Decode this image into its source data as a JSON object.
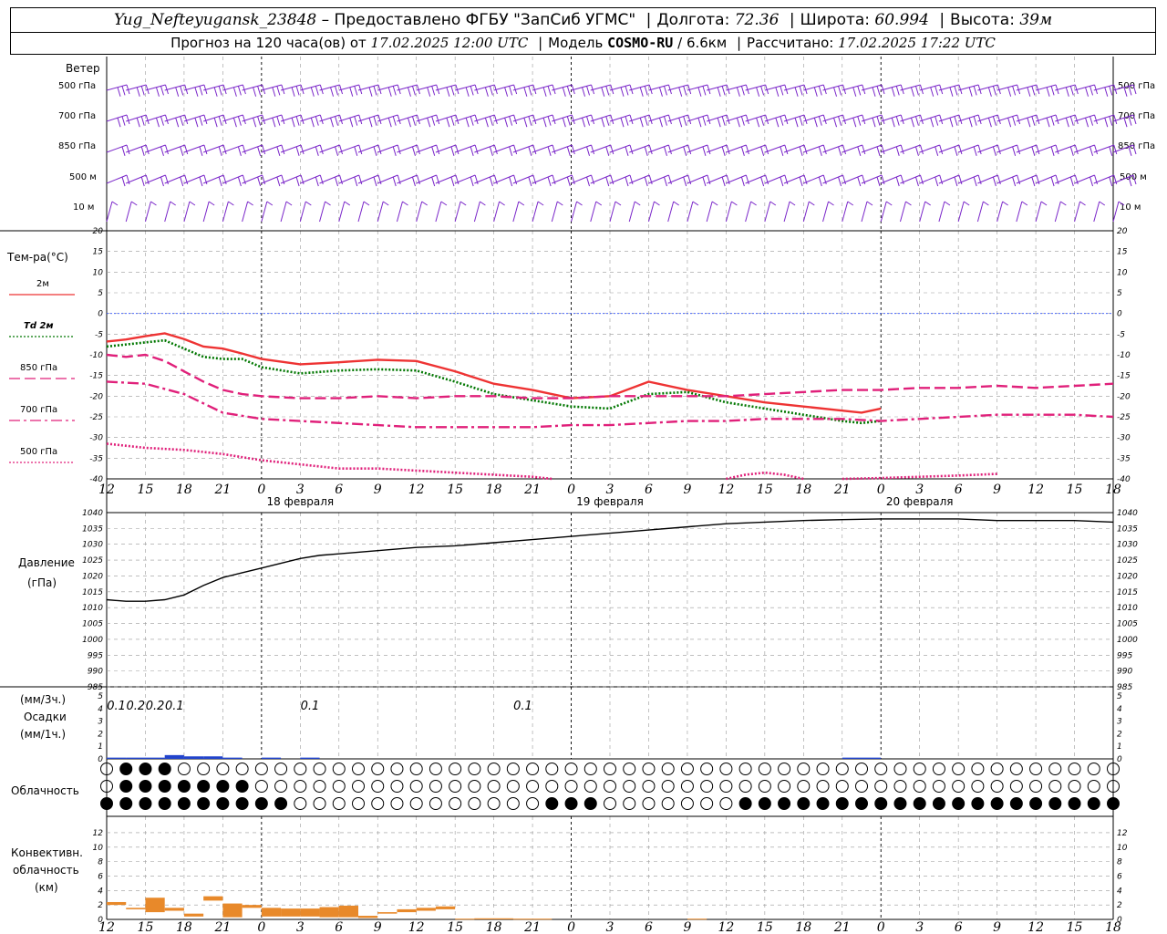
{
  "header": {
    "station": "Yug_Nefteyugansk_23848",
    "provider": "– Предоставлено ФГБУ \"ЗапСиб УГМС\"",
    "lon_label": "Долгота:",
    "lon": "72.36",
    "lat_label": "Широта:",
    "lat": "60.994",
    "alt_label": "Высота:",
    "alt": "39м",
    "forecast_label": "Прогноз на 120 часа(ов) от",
    "forecast_time": "17.02.2025 12:00 UTC",
    "model_label": "Модель",
    "model": "COSMO-RU",
    "model_res": "/ 6.6км",
    "calc_label": "Рассчитано:",
    "calc_time": "17.02.2025 17:22 UTC"
  },
  "wind": {
    "title": "Ветер",
    "levels": [
      "500 гПа",
      "700 гПа",
      "850 гПа",
      "500 м",
      "10 м"
    ],
    "color": "#7a26c9"
  },
  "temp_panel": {
    "title": "Тем-ра(°C)",
    "legend": [
      {
        "label": "2м",
        "color": "#ee3333",
        "style": "solid"
      },
      {
        "label": "Td 2м",
        "color": "#007700",
        "style": "dotted"
      },
      {
        "label": "850 гПа",
        "color": "#e0207a",
        "style": "dashed"
      },
      {
        "label": "700 гПа",
        "color": "#e0207a",
        "style": "dashdot"
      },
      {
        "label": "500 гПа",
        "color": "#e0207a",
        "style": "dotted"
      }
    ],
    "yticks": [
      "20",
      "15",
      "10",
      "5",
      "0",
      "-5",
      "-10",
      "-15",
      "-20",
      "-25",
      "-30",
      "-35",
      "-40"
    ]
  },
  "hour_ticks": [
    "12",
    "15",
    "18",
    "21",
    "0",
    "3",
    "6",
    "9",
    "12",
    "15",
    "18",
    "21",
    "0",
    "3",
    "6",
    "9",
    "12",
    "15",
    "18",
    "21",
    "0",
    "3",
    "6",
    "9",
    "12",
    "15",
    "18"
  ],
  "dates": [
    "18 февраля",
    "19 февраля",
    "20 февраля"
  ],
  "pressure_panel": {
    "title": "Давление",
    "unit": "(гПа)",
    "yticks": [
      "1040",
      "1035",
      "1030",
      "1025",
      "1020",
      "1015",
      "1010",
      "1005",
      "1000",
      "995",
      "990",
      "985"
    ]
  },
  "precip_panel": {
    "unit_3h": "(мм/3ч.)",
    "title": "Осадки",
    "unit_1h": "(мм/1ч.)",
    "yticks": [
      "5",
      "4",
      "3",
      "2",
      "1",
      "0"
    ],
    "labels": [
      {
        "hour": 1.5,
        "text": "0.1"
      },
      {
        "hour": 4.5,
        "text": "0.2"
      },
      {
        "hour": 7.5,
        "text": "0.2"
      },
      {
        "hour": 10.5,
        "text": "0.1"
      },
      {
        "hour": 31.5,
        "text": "0.1"
      },
      {
        "hour": 64.5,
        "text": "0.1"
      }
    ]
  },
  "cloud_panel": {
    "title": "Облачность"
  },
  "conv_panel": {
    "title1": "Конвективн.",
    "title2": "облачность",
    "unit": "(км)",
    "yticks": [
      "12",
      "10",
      "8",
      "6",
      "4",
      "2",
      "0"
    ]
  },
  "chart_data": [
    {
      "type": "line",
      "title": "Тем-ра(°C)",
      "x_unit": "hours from 17.02.2025 12:00 UTC",
      "ylim": [
        -40,
        20
      ],
      "series": [
        {
          "name": "2м",
          "x": [
            0,
            3,
            6,
            9,
            12,
            15,
            18,
            21,
            24,
            30,
            36,
            42,
            48,
            54,
            60,
            66,
            72,
            78,
            84,
            90,
            96,
            102,
            108,
            114,
            117,
            120
          ],
          "values": [
            -6.8,
            -6.3,
            -5.5,
            -4.8,
            -6.2,
            -8.0,
            -8.5,
            -9.7,
            -11.0,
            -12.3,
            -11.8,
            -11.2,
            -11.5,
            -14.0,
            -17.0,
            -18.5,
            -20.5,
            -20.0,
            -16.5,
            -18.5,
            -20.0,
            -21.5,
            -22.5,
            -23.5,
            -24.0,
            -23.0
          ]
        },
        {
          "name": "Td 2м",
          "x": [
            0,
            3,
            6,
            9,
            12,
            15,
            18,
            21,
            24,
            30,
            36,
            42,
            48,
            54,
            60,
            66,
            72,
            78,
            84,
            90,
            96,
            102,
            108,
            114,
            117,
            120
          ],
          "values": [
            -8.0,
            -7.5,
            -7.0,
            -6.5,
            -8.5,
            -10.5,
            -11.0,
            -11.0,
            -13.0,
            -14.5,
            -13.8,
            -13.5,
            -13.8,
            -16.5,
            -19.5,
            -21.0,
            -22.5,
            -23.0,
            -19.5,
            -19.0,
            -21.5,
            -23.0,
            -24.5,
            -26.0,
            -26.5,
            -26.0
          ]
        },
        {
          "name": "850 гПа",
          "x": [
            0,
            3,
            6,
            9,
            12,
            15,
            18,
            21,
            24,
            30,
            36,
            42,
            48,
            54,
            60,
            66,
            72,
            78,
            84,
            90,
            96,
            102,
            108,
            114,
            120,
            126,
            132,
            138,
            144,
            150,
            156
          ],
          "values": [
            -10.0,
            -10.5,
            -10.0,
            -11.5,
            -14.0,
            -16.5,
            -18.5,
            -19.5,
            -20.0,
            -20.5,
            -20.5,
            -20.0,
            -20.5,
            -20.0,
            -20.0,
            -20.5,
            -20.5,
            -20.0,
            -20.0,
            -20.0,
            -20.0,
            -19.5,
            -19.0,
            -18.5,
            -18.5,
            -18.0,
            -18.0,
            -17.5,
            -18.0,
            -17.5,
            -17.0
          ]
        },
        {
          "name": "700 гПа",
          "x": [
            0,
            6,
            12,
            18,
            24,
            30,
            36,
            42,
            48,
            54,
            60,
            66,
            72,
            78,
            84,
            90,
            96,
            102,
            108,
            114,
            120,
            126,
            132,
            138,
            144,
            150,
            156
          ],
          "values": [
            -16.5,
            -17.0,
            -19.5,
            -24.0,
            -25.5,
            -26.0,
            -26.5,
            -27.0,
            -27.5,
            -27.5,
            -27.5,
            -27.5,
            -27.0,
            -27.0,
            -26.5,
            -26.0,
            -26.0,
            -25.5,
            -25.5,
            -25.5,
            -26.0,
            -25.5,
            -25.0,
            -24.5,
            -24.5,
            -24.5,
            -25.0
          ]
        },
        {
          "name": "500 гПа",
          "x": [
            0,
            6,
            12,
            18,
            24,
            30,
            36,
            42,
            48,
            54,
            60,
            66,
            69
          ],
          "values": [
            -31.5,
            -32.5,
            -33.0,
            -34.0,
            -35.5,
            -36.5,
            -37.5,
            -37.5,
            -38.0,
            -38.5,
            -39.0,
            -39.5,
            -40.0
          ]
        }
      ]
    },
    {
      "type": "line",
      "title": "Давление",
      "x_unit": "hours from 17.02.2025 12:00 UTC",
      "ylim": [
        985,
        1040
      ],
      "series": [
        {
          "name": "Давление",
          "x": [
            0,
            3,
            6,
            9,
            12,
            15,
            18,
            21,
            24,
            27,
            30,
            33,
            36,
            39,
            42,
            45,
            48,
            54,
            60,
            66,
            72,
            78,
            84,
            90,
            96,
            102,
            108,
            114,
            120,
            126,
            132,
            138,
            144,
            150,
            156
          ],
          "values": [
            1012.5,
            1012,
            1012,
            1012.5,
            1014,
            1017,
            1019.5,
            1021,
            1022.5,
            1024,
            1025.5,
            1026.5,
            1027,
            1027.5,
            1028,
            1028.5,
            1029,
            1029.5,
            1030.5,
            1031.5,
            1032.5,
            1033.5,
            1034.5,
            1035.5,
            1036.5,
            1037,
            1037.5,
            1037.8,
            1038,
            1038,
            1038,
            1037.5,
            1037.5,
            1037.5,
            1037
          ]
        }
      ]
    },
    {
      "type": "bar",
      "title": "Осадки",
      "x_unit": "hours from 17.02.2025 12:00 UTC",
      "ylim": [
        0,
        5
      ],
      "x": [
        0,
        3,
        6,
        9,
        12,
        15,
        18,
        21,
        24,
        30,
        36,
        42,
        48,
        54,
        60,
        66,
        72,
        78,
        84,
        90,
        96,
        102,
        108,
        114,
        117,
        120
      ],
      "values": [
        0.1,
        0.1,
        0.1,
        0.3,
        0.2,
        0.2,
        0.1,
        0.0,
        0.1,
        0.1,
        0.0,
        0.0,
        0.0,
        0.0,
        0.0,
        0.0,
        0.0,
        0.0,
        0.0,
        0.0,
        0.0,
        0.0,
        0.0,
        0.1,
        0.1,
        0.0
      ]
    },
    {
      "type": "bar",
      "title": "Конвективн. облачность",
      "x_unit": "hours from 17.02.2025 12:00 UTC",
      "ylim": [
        0,
        13
      ],
      "bars": [
        {
          "x": 0,
          "bottom": 2.0,
          "top": 2.4
        },
        {
          "x": 3,
          "bottom": 1.4,
          "top": 1.6
        },
        {
          "x": 6,
          "bottom": 1.0,
          "top": 3.0
        },
        {
          "x": 9,
          "bottom": 1.2,
          "top": 1.6
        },
        {
          "x": 12,
          "bottom": 0.4,
          "top": 0.8
        },
        {
          "x": 15,
          "bottom": 2.6,
          "top": 3.2
        },
        {
          "x": 18,
          "bottom": 0.3,
          "top": 2.2
        },
        {
          "x": 21,
          "bottom": 1.6,
          "top": 2.0
        },
        {
          "x": 24,
          "bottom": 0.4,
          "top": 1.6
        },
        {
          "x": 27,
          "bottom": 0.4,
          "top": 1.5
        },
        {
          "x": 30,
          "bottom": 0.4,
          "top": 1.5
        },
        {
          "x": 33,
          "bottom": 0.3,
          "top": 1.7
        },
        {
          "x": 36,
          "bottom": 0.3,
          "top": 1.9
        },
        {
          "x": 39,
          "bottom": 0.2,
          "top": 0.5
        },
        {
          "x": 42,
          "bottom": 0.8,
          "top": 1.0
        },
        {
          "x": 45,
          "bottom": 1.0,
          "top": 1.4
        },
        {
          "x": 48,
          "bottom": 1.2,
          "top": 1.6
        },
        {
          "x": 51,
          "bottom": 1.4,
          "top": 1.8
        },
        {
          "x": 54,
          "bottom": 0.0,
          "top": 0.1
        },
        {
          "x": 57,
          "bottom": 0.0,
          "top": 0.15
        },
        {
          "x": 60,
          "bottom": 0.0,
          "top": 0.15
        },
        {
          "x": 63,
          "bottom": 0.0,
          "top": 0.1
        },
        {
          "x": 66,
          "bottom": 0.0,
          "top": 0.1
        },
        {
          "x": 90,
          "bottom": 0.0,
          "top": 0.1
        }
      ]
    }
  ]
}
